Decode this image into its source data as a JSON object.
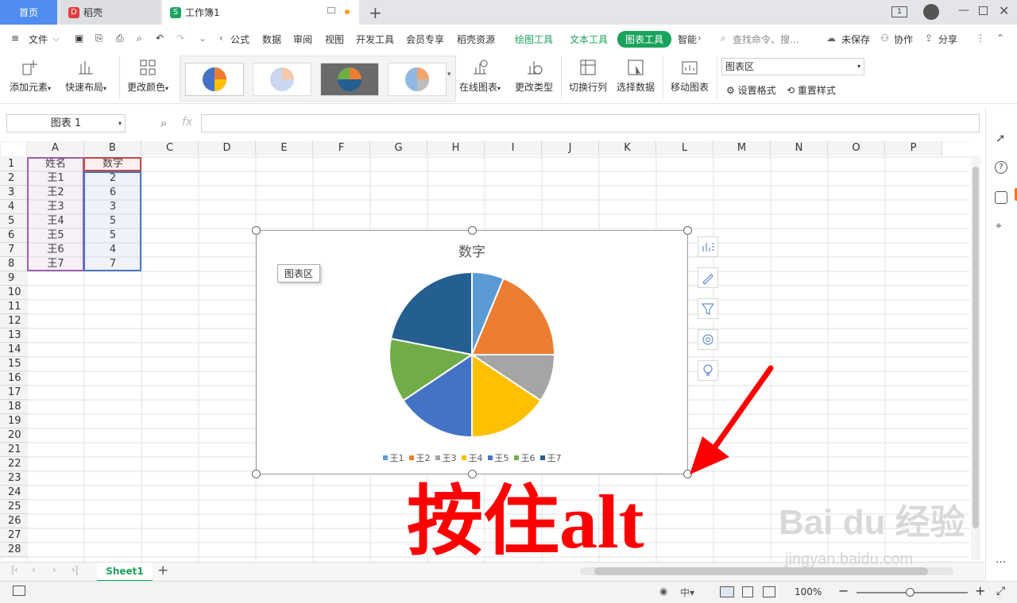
{
  "tabs": {
    "home": "首页",
    "daoke": "稻壳",
    "workbook": "工作簿1"
  },
  "menu": [
    "文件",
    "公式",
    "数据",
    "审阅",
    "视图",
    "开发工具",
    "会员专享",
    "稻壳资源",
    "绘图工具",
    "文本工具",
    "图表工具",
    "智能"
  ],
  "menu_right": {
    "search": "查找命令、搜...",
    "unsaved": "未保存",
    "collab": "协作",
    "share": "分享"
  },
  "ribbon": {
    "add_element": "添加元素",
    "quick_layout": "快速布局",
    "change_color": "更改颜色",
    "online_chart": "在线图表",
    "change_type": "更改类型",
    "switch_rowcol": "切换行列",
    "select_data": "选择数据",
    "move_chart": "移动图表",
    "chart_area": "图表区",
    "set_format": "设置格式",
    "reset_style": "重置样式"
  },
  "formula": {
    "namebox": "图表 1",
    "fx": "fx"
  },
  "columns": [
    "A",
    "B",
    "C",
    "D",
    "E",
    "F",
    "G",
    "H",
    "I",
    "J",
    "K",
    "L",
    "M",
    "N",
    "O",
    "P"
  ],
  "rows": [
    "1",
    "2",
    "3",
    "4",
    "5",
    "6",
    "7",
    "8",
    "9",
    "10",
    "11",
    "12",
    "13",
    "14",
    "15",
    "16",
    "17",
    "18",
    "19",
    "20",
    "21",
    "22",
    "23",
    "24",
    "25",
    "26",
    "27",
    "28"
  ],
  "table": {
    "header": [
      "姓名",
      "数字"
    ],
    "data": [
      [
        "王1",
        "2"
      ],
      [
        "王2",
        "6"
      ],
      [
        "王3",
        "3"
      ],
      [
        "王4",
        "5"
      ],
      [
        "王5",
        "5"
      ],
      [
        "王6",
        "4"
      ],
      [
        "王7",
        "7"
      ]
    ]
  },
  "chart_data": {
    "type": "pie",
    "title": "数字",
    "categories": [
      "王1",
      "王2",
      "王3",
      "王4",
      "王5",
      "王6",
      "王7"
    ],
    "values": [
      2,
      6,
      3,
      5,
      5,
      4,
      7
    ],
    "colors": [
      "#5b9bd5",
      "#ed7d31",
      "#a5a5a5",
      "#ffc000",
      "#4472c4",
      "#70ad47",
      "#255e91"
    ],
    "legend": "bottom"
  },
  "chart_tooltip": "图表区",
  "sheet": {
    "name": "Sheet1"
  },
  "status": {
    "zoom": "100%"
  },
  "overlay": {
    "text": "按住alt",
    "watermark": "Bai du 经验",
    "watermark_url": "jingyan.baidu.com"
  }
}
